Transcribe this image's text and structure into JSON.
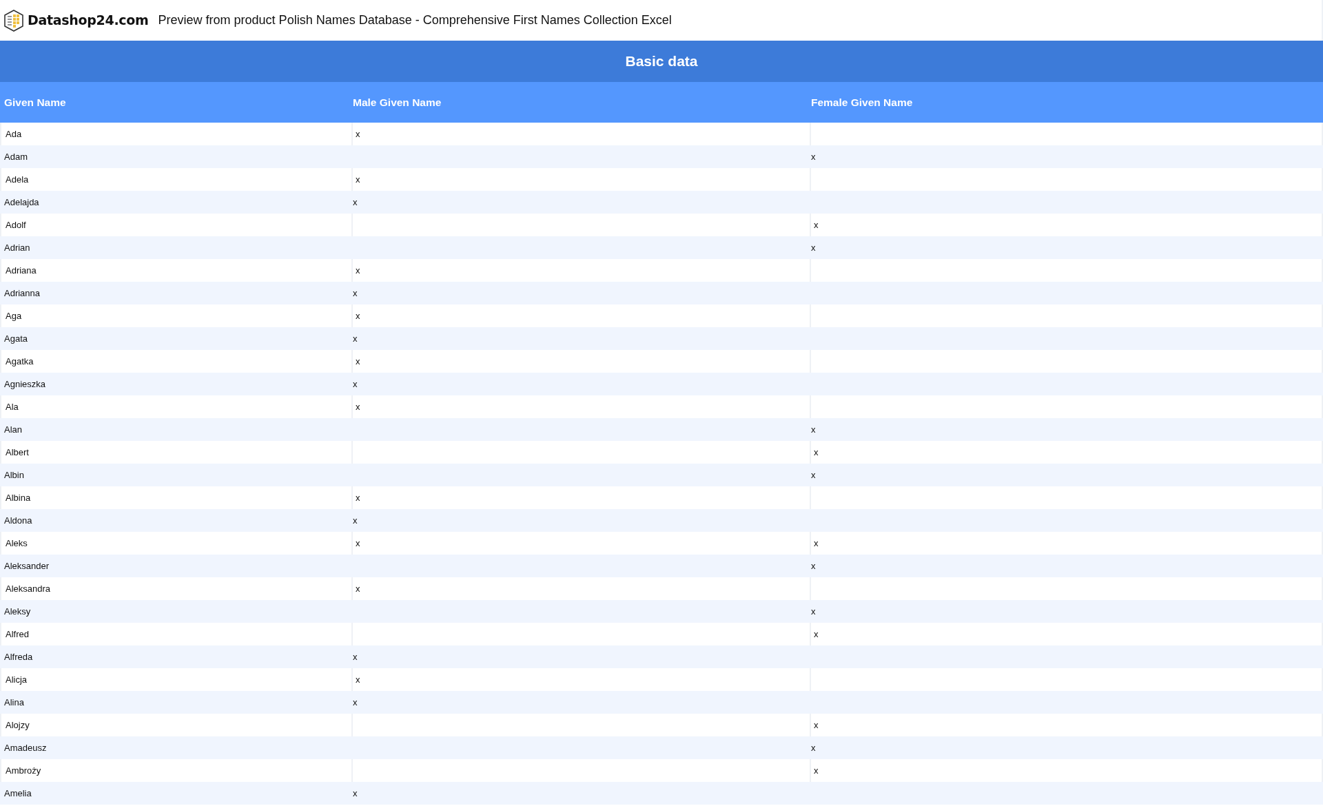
{
  "header": {
    "brand": "Datashop24.com",
    "title": "Preview from product Polish Names Database - Comprehensive First Names Collection Excel"
  },
  "table": {
    "caption": "Basic data",
    "columns": [
      "Given Name",
      "Male Given Name",
      "Female Given Name"
    ],
    "rows": [
      {
        "given_name": "Ada",
        "male": "x"
      },
      {
        "given_name": "Adam",
        "female": "x"
      },
      {
        "given_name": "Adela",
        "male": "x"
      },
      {
        "given_name": "Adelajda",
        "male": "x"
      },
      {
        "given_name": "Adolf",
        "female": "x"
      },
      {
        "given_name": "Adrian",
        "female": "x"
      },
      {
        "given_name": "Adriana",
        "male": "x"
      },
      {
        "given_name": "Adrianna",
        "male": "x"
      },
      {
        "given_name": "Aga",
        "male": "x"
      },
      {
        "given_name": "Agata",
        "male": "x"
      },
      {
        "given_name": "Agatka",
        "male": "x"
      },
      {
        "given_name": "Agnieszka",
        "male": "x"
      },
      {
        "given_name": "Ala",
        "male": "x"
      },
      {
        "given_name": "Alan",
        "female": "x"
      },
      {
        "given_name": "Albert",
        "female": "x"
      },
      {
        "given_name": "Albin",
        "female": "x"
      },
      {
        "given_name": "Albina",
        "male": "x"
      },
      {
        "given_name": "Aldona",
        "male": "x"
      },
      {
        "given_name": "Aleks",
        "male": "x",
        "female": "x"
      },
      {
        "given_name": "Aleksander",
        "female": "x"
      },
      {
        "given_name": "Aleksandra",
        "male": "x"
      },
      {
        "given_name": "Aleksy",
        "female": "x"
      },
      {
        "given_name": "Alfred",
        "female": "x"
      },
      {
        "given_name": "Alfreda",
        "male": "x"
      },
      {
        "given_name": "Alicja",
        "male": "x"
      },
      {
        "given_name": "Alina",
        "male": "x"
      },
      {
        "given_name": "Alojzy",
        "female": "x"
      },
      {
        "given_name": "Amadeusz",
        "female": "x"
      },
      {
        "given_name": "Ambroży",
        "female": "x"
      },
      {
        "given_name": "Amelia",
        "male": "x"
      }
    ]
  }
}
